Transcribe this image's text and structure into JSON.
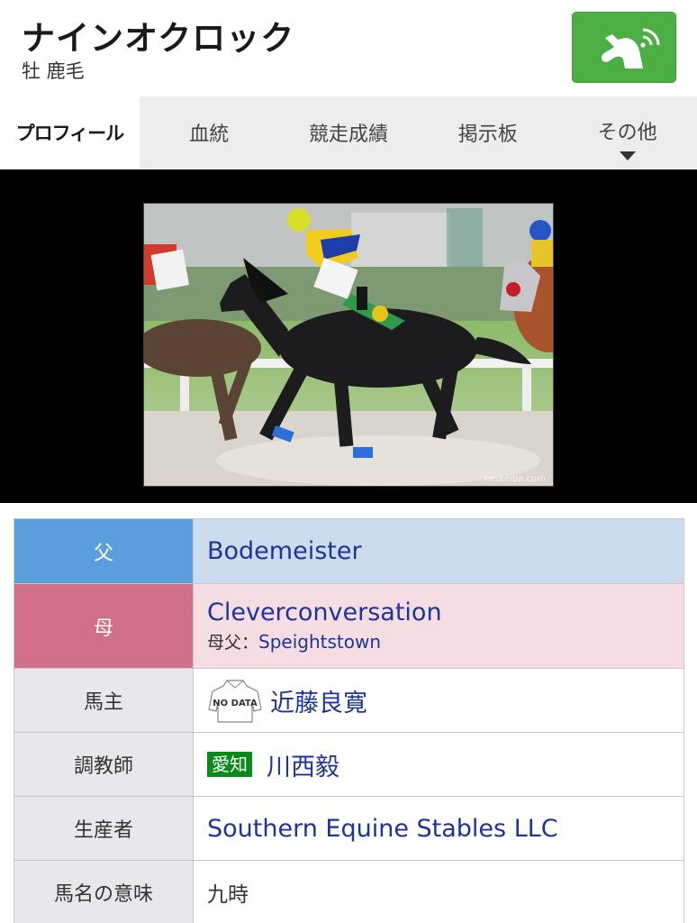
{
  "header": {
    "horse_name": "ナインオクロック",
    "sex_color": "牡 鹿毛",
    "favorite_button_color": "#4caf45"
  },
  "tabs": [
    {
      "label": "プロフィール",
      "active": true
    },
    {
      "label": "血統",
      "active": false
    },
    {
      "label": "競走成績",
      "active": false
    },
    {
      "label": "掲示板",
      "active": false
    },
    {
      "label": "その他",
      "active": false
    }
  ],
  "photo": {
    "watermark": "netkeiba.com"
  },
  "profile": {
    "sire_label": "父",
    "sire": "Bodemeister",
    "dam_label": "母",
    "dam": "Cleverconversation",
    "damsire_label": "母父：",
    "damsire": "Speightstown",
    "owner_label": "馬主",
    "owner_silks_text": "NO DATA",
    "owner": "近藤良寛",
    "trainer_label": "調教師",
    "trainer_region": "愛知",
    "trainer": "川西毅",
    "breeder_label": "生産者",
    "breeder": "Southern Equine Stables LLC",
    "name_meaning_label": "馬名の意味",
    "name_meaning": "九時"
  },
  "colors": {
    "sire_label_bg": "#5a9fdc",
    "sire_row_bg": "#cbdcef",
    "dam_label_bg": "#d07086",
    "dam_row_bg": "#f5dde3",
    "link": "#1b3598",
    "region_badge": "#0a8a18"
  },
  "icons": {
    "favorite": "horse-head-rss-icon",
    "more": "caret-down-icon"
  }
}
